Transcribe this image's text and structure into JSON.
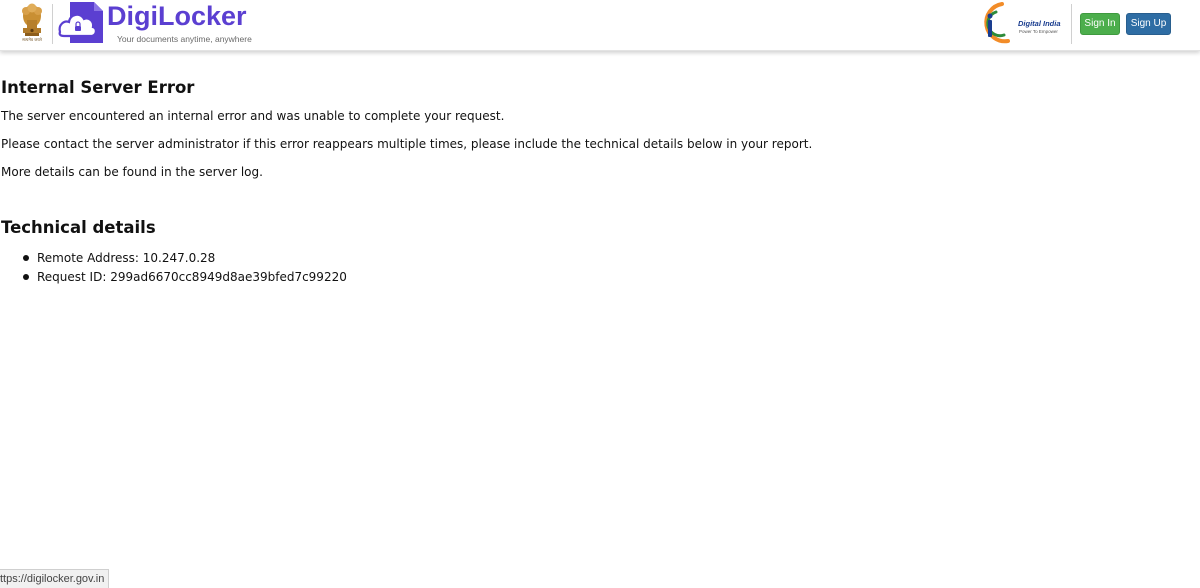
{
  "header": {
    "emblem_caption": "सत्यमेव जयते",
    "brand_name": "DigiLocker",
    "brand_tagline": "Your documents anytime, anywhere",
    "partner_name": "Digital India",
    "partner_tagline": "Power To Empower",
    "signin_label": "Sign In",
    "signup_label": "Sign Up",
    "brand_color": "#5b3fd1",
    "signin_color": "#4cae4c",
    "signup_color": "#2e6da4"
  },
  "error": {
    "title": "Internal Server Error",
    "paragraphs": [
      "The server encountered an internal error and was unable to complete your request.",
      "Please contact the server administrator if this error reappears multiple times, please include the technical details below in your report.",
      "More details can be found in the server log."
    ]
  },
  "technical": {
    "title": "Technical details",
    "items": [
      "Remote Address: 10.247.0.28",
      "Request ID: 299ad6670cc8949d8ae39bfed7c99220"
    ]
  },
  "statusbar": {
    "url": "ttps://digilocker.gov.in"
  }
}
